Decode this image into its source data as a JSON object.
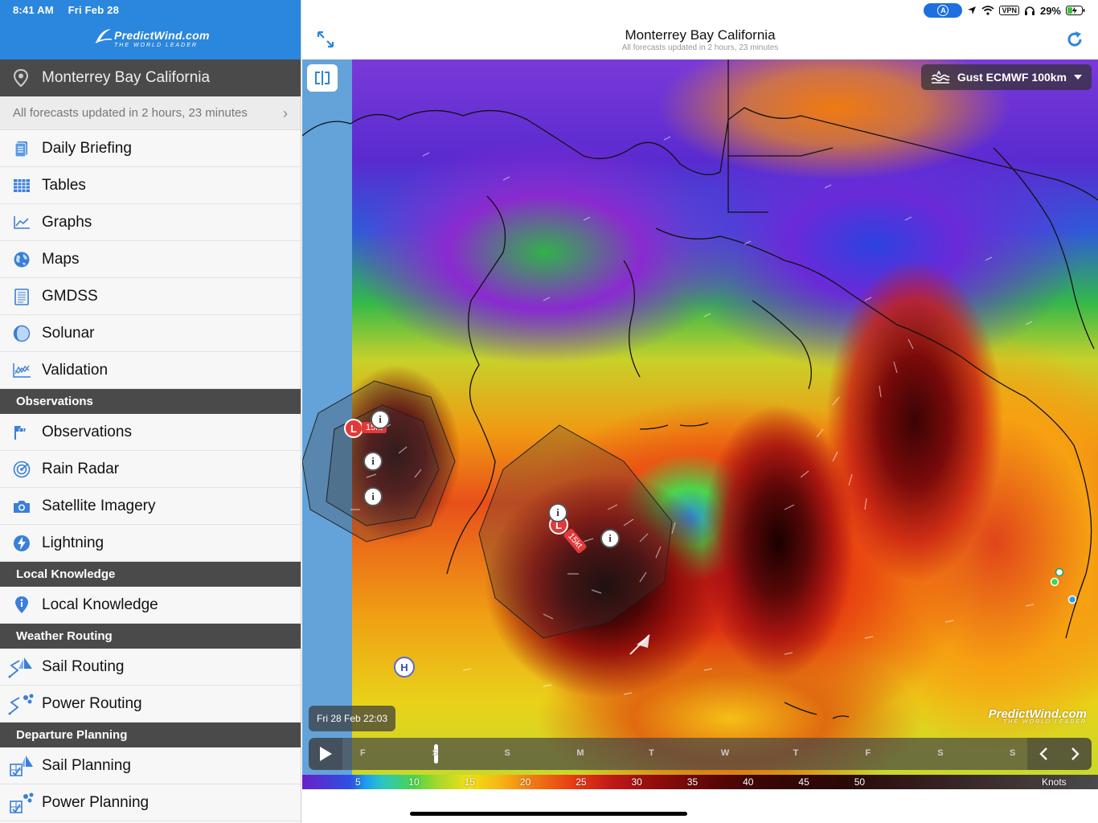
{
  "status": {
    "time": "8:41 AM",
    "date": "Fri Feb 28",
    "battery": "29%",
    "vpn": "VPN"
  },
  "brand": {
    "name": "PredictWind.com",
    "tagline": "THE WORLD LEADER"
  },
  "location": {
    "name": "Monterrey Bay California"
  },
  "updated": {
    "text": "All forecasts updated in 2 hours, 23 minutes"
  },
  "menu": {
    "daily_briefing": "Daily Briefing",
    "tables": "Tables",
    "graphs": "Graphs",
    "maps": "Maps",
    "gmdss": "GMDSS",
    "solunar": "Solunar",
    "validation": "Validation",
    "observations_header": "Observations",
    "observations": "Observations",
    "rain_radar": "Rain Radar",
    "satellite_imagery": "Satellite Imagery",
    "lightning": "Lightning",
    "local_knowledge_header": "Local Knowledge",
    "local_knowledge": "Local Knowledge",
    "weather_routing_header": "Weather Routing",
    "sail_routing": "Sail Routing",
    "power_routing": "Power Routing",
    "departure_planning_header": "Departure Planning",
    "sail_planning": "Sail Planning",
    "power_planning": "Power Planning"
  },
  "header": {
    "title": "Monterrey Bay California",
    "subtitle": "All forecasts updated in 2 hours, 23 minutes"
  },
  "map": {
    "layer": "Gust ECMWF 100km",
    "timestamp": "Fri 28 Feb 22:03",
    "markers": {
      "low": "L",
      "high": "H",
      "info": "i",
      "low_speed": "15kt"
    }
  },
  "timeline": {
    "days": [
      "F",
      "S",
      "S",
      "M",
      "T",
      "W",
      "T",
      "F",
      "S",
      "S"
    ],
    "progress": 0.07
  },
  "legend": {
    "values": [
      "5",
      "10",
      "15",
      "20",
      "25",
      "30",
      "35",
      "40",
      "45",
      "50"
    ],
    "unit": "Knots"
  },
  "colors": {
    "brand_blue": "#2b86dd",
    "section_dark": "#4a4a4a",
    "accent_blue": "#1f6fe0"
  }
}
